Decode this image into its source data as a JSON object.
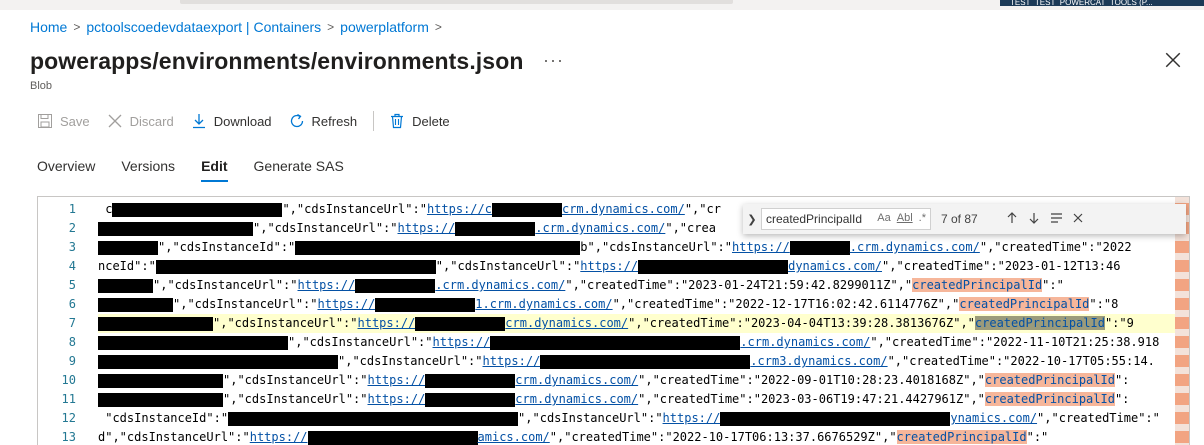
{
  "account": {
    "name": "TEST_TEST_POWERCAT_TOOLS (P..."
  },
  "breadcrumb": [
    {
      "label": "Home"
    },
    {
      "label": "pctoolscoedevdataexport | Containers"
    },
    {
      "label": "powerplatform"
    }
  ],
  "header": {
    "title": "powerapps/environments/environments.json",
    "subtitle": "Blob",
    "more": "···"
  },
  "toolbar": {
    "save": "Save",
    "discard": "Discard",
    "download": "Download",
    "refresh": "Refresh",
    "delete": "Delete"
  },
  "tabs": [
    {
      "label": "Overview",
      "active": false
    },
    {
      "label": "Versions",
      "active": false
    },
    {
      "label": "Edit",
      "active": true
    },
    {
      "label": "Generate SAS",
      "active": false
    }
  ],
  "find": {
    "query": "createdPrincipalId",
    "case_label": "Aa",
    "word_label": "Abl",
    "regex_label": ".*",
    "count": "7 of 87"
  },
  "editor": {
    "line_numbers": [
      "1",
      "2",
      "3",
      "4",
      "5",
      "6",
      "7",
      "8",
      "9",
      "10",
      "11",
      "12",
      "13"
    ],
    "current_line": 7,
    "lines": [
      [
        {
          "t": "mark",
          "w": 170,
          "pre": " c"
        },
        {
          "t": "k",
          "v": "\",\"cdsInstanceUrl\":\""
        },
        {
          "t": "u",
          "v": "https://c"
        },
        {
          "t": "mark",
          "w": 70
        },
        {
          "t": "u",
          "v": "crm.dynamics.com/"
        },
        {
          "t": "k",
          "v": "\",\"cr"
        }
      ],
      [
        {
          "t": "mark",
          "w": 155
        },
        {
          "t": "k",
          "v": "\",\"cdsInstanceUrl\":\""
        },
        {
          "t": "u",
          "v": "https://"
        },
        {
          "t": "mark",
          "w": 80
        },
        {
          "t": "u",
          "v": ".crm.dynamics.com/"
        },
        {
          "t": "k",
          "v": "\",\"crea"
        }
      ],
      [
        {
          "t": "mark",
          "w": 60
        },
        {
          "t": "k",
          "v": "\",\"cdsInstanceId\":\""
        },
        {
          "t": "mark",
          "w": 285
        },
        {
          "t": "k",
          "v": "b\",\"cdsInstanceUrl\":\""
        },
        {
          "t": "u",
          "v": "https://"
        },
        {
          "t": "mark",
          "w": 60
        },
        {
          "t": "u",
          "v": ".crm.dynamics.com/"
        },
        {
          "t": "k",
          "v": "\",\"createdTime\":\"2022"
        }
      ],
      [
        {
          "t": "k",
          "v": "nceId\":\""
        },
        {
          "t": "mark",
          "w": 280
        },
        {
          "t": "k",
          "v": "\",\"cdsInstanceUrl\":\""
        },
        {
          "t": "u",
          "v": "https://"
        },
        {
          "t": "mark",
          "w": 150
        },
        {
          "t": "u",
          "v": "dynamics.com/"
        },
        {
          "t": "k",
          "v": "\",\"createdTime\":\"2023-01-12T13:46"
        }
      ],
      [
        {
          "t": "mark",
          "w": 55
        },
        {
          "t": "k",
          "v": "\",\"cdsInstanceUrl\":\""
        },
        {
          "t": "u",
          "v": "https://"
        },
        {
          "t": "mark",
          "w": 80
        },
        {
          "t": "u",
          "v": ".crm.dynamics.com/"
        },
        {
          "t": "k",
          "v": "\",\"createdTime\":\"2023-01-24T21:59:42.8299011Z\",\""
        },
        {
          "t": "hl",
          "v": "createdPrincipalId"
        },
        {
          "t": "k",
          "v": "\":\""
        }
      ],
      [
        {
          "t": "mark",
          "w": 75
        },
        {
          "t": "k",
          "v": "\",\"cdsInstanceUrl\":\""
        },
        {
          "t": "u",
          "v": "https://"
        },
        {
          "t": "mark",
          "w": 100
        },
        {
          "t": "u",
          "v": "1.crm.dynamics.com/"
        },
        {
          "t": "k",
          "v": "\",\"createdTime\":\"2022-12-17T16:02:42.6114776Z\",\""
        },
        {
          "t": "hl",
          "v": "createdPrincipalId"
        },
        {
          "t": "k",
          "v": "\":\"8"
        }
      ],
      [
        {
          "t": "mark",
          "w": 115
        },
        {
          "t": "k",
          "v": "\",\"cdsInstanceUrl\":\""
        },
        {
          "t": "u",
          "v": "https://"
        },
        {
          "t": "mark",
          "w": 90
        },
        {
          "t": "u",
          "v": "crm.dynamics.com/"
        },
        {
          "t": "k",
          "v": "\",\"createdTime\":\"2023-04-04T13:39:28.3813676Z\",\""
        },
        {
          "t": "hlc",
          "v": "createdPrincipalId"
        },
        {
          "t": "k",
          "v": "\":\"9"
        }
      ],
      [
        {
          "t": "mark",
          "w": 190
        },
        {
          "t": "k",
          "v": "\",\"cdsInstanceUrl\":\""
        },
        {
          "t": "u",
          "v": "https://"
        },
        {
          "t": "mark",
          "w": 250
        },
        {
          "t": "u",
          "v": ".crm.dynamics.com/"
        },
        {
          "t": "k",
          "v": "\",\"createdTime\":\"2022-11-10T21:25:38.918"
        }
      ],
      [
        {
          "t": "mark",
          "w": 240
        },
        {
          "t": "k",
          "v": "\",\"cdsInstanceUrl\":\""
        },
        {
          "t": "u",
          "v": "https://"
        },
        {
          "t": "mark",
          "w": 210
        },
        {
          "t": "u",
          "v": ".crm3.dynamics.com/"
        },
        {
          "t": "k",
          "v": "\",\"createdTime\":\"2022-10-17T05:55:14."
        }
      ],
      [
        {
          "t": "mark",
          "w": 125
        },
        {
          "t": "k",
          "v": "\",\"cdsInstanceUrl\":\""
        },
        {
          "t": "u",
          "v": "https://"
        },
        {
          "t": "mark",
          "w": 90
        },
        {
          "t": "u",
          "v": "crm.dynamics.com/"
        },
        {
          "t": "k",
          "v": "\",\"createdTime\":\"2022-09-01T10:28:23.4018168Z\",\""
        },
        {
          "t": "hl",
          "v": "createdPrincipalId"
        },
        {
          "t": "k",
          "v": "\":"
        }
      ],
      [
        {
          "t": "mark",
          "w": 125
        },
        {
          "t": "k",
          "v": "\",\"cdsInstanceUrl\":\""
        },
        {
          "t": "u",
          "v": "https://"
        },
        {
          "t": "mark",
          "w": 90
        },
        {
          "t": "u",
          "v": "crm.dynamics.com/"
        },
        {
          "t": "k",
          "v": "\",\"createdTime\":\"2023-03-06T19:47:21.4427961Z\",\""
        },
        {
          "t": "hl",
          "v": "createdPrincipalId"
        },
        {
          "t": "k",
          "v": "\":"
        }
      ],
      [
        {
          "t": "k",
          "v": " \"cdsInstanceId\":\""
        },
        {
          "t": "mark",
          "w": 290
        },
        {
          "t": "k",
          "v": "\",\"cdsInstanceUrl\":\""
        },
        {
          "t": "u",
          "v": "https://"
        },
        {
          "t": "mark",
          "w": 230
        },
        {
          "t": "u",
          "v": "ynamics.com/"
        },
        {
          "t": "k",
          "v": "\",\"createdTime\":\""
        }
      ],
      [
        {
          "t": "k",
          "v": "d\",\"cdsInstanceUrl\":\""
        },
        {
          "t": "u",
          "v": "https://"
        },
        {
          "t": "mark",
          "w": 170
        },
        {
          "t": "u",
          "v": "amics.com/"
        },
        {
          "t": "k",
          "v": "\",\"createdTime\":\"2022-10-17T06:13:37.6676529Z\",\""
        },
        {
          "t": "hl",
          "v": "createdPrincipalId"
        },
        {
          "t": "k",
          "v": "\":\""
        }
      ]
    ]
  },
  "colors": {
    "accent": "#0078d4",
    "match_highlight": "#f6b69a",
    "current_line": "#ffffce",
    "redaction": "#000000"
  },
  "icons": {
    "save": "save-icon",
    "discard": "discard-icon",
    "download": "download-icon",
    "refresh": "refresh-icon",
    "delete": "delete-icon",
    "close": "close-icon"
  }
}
